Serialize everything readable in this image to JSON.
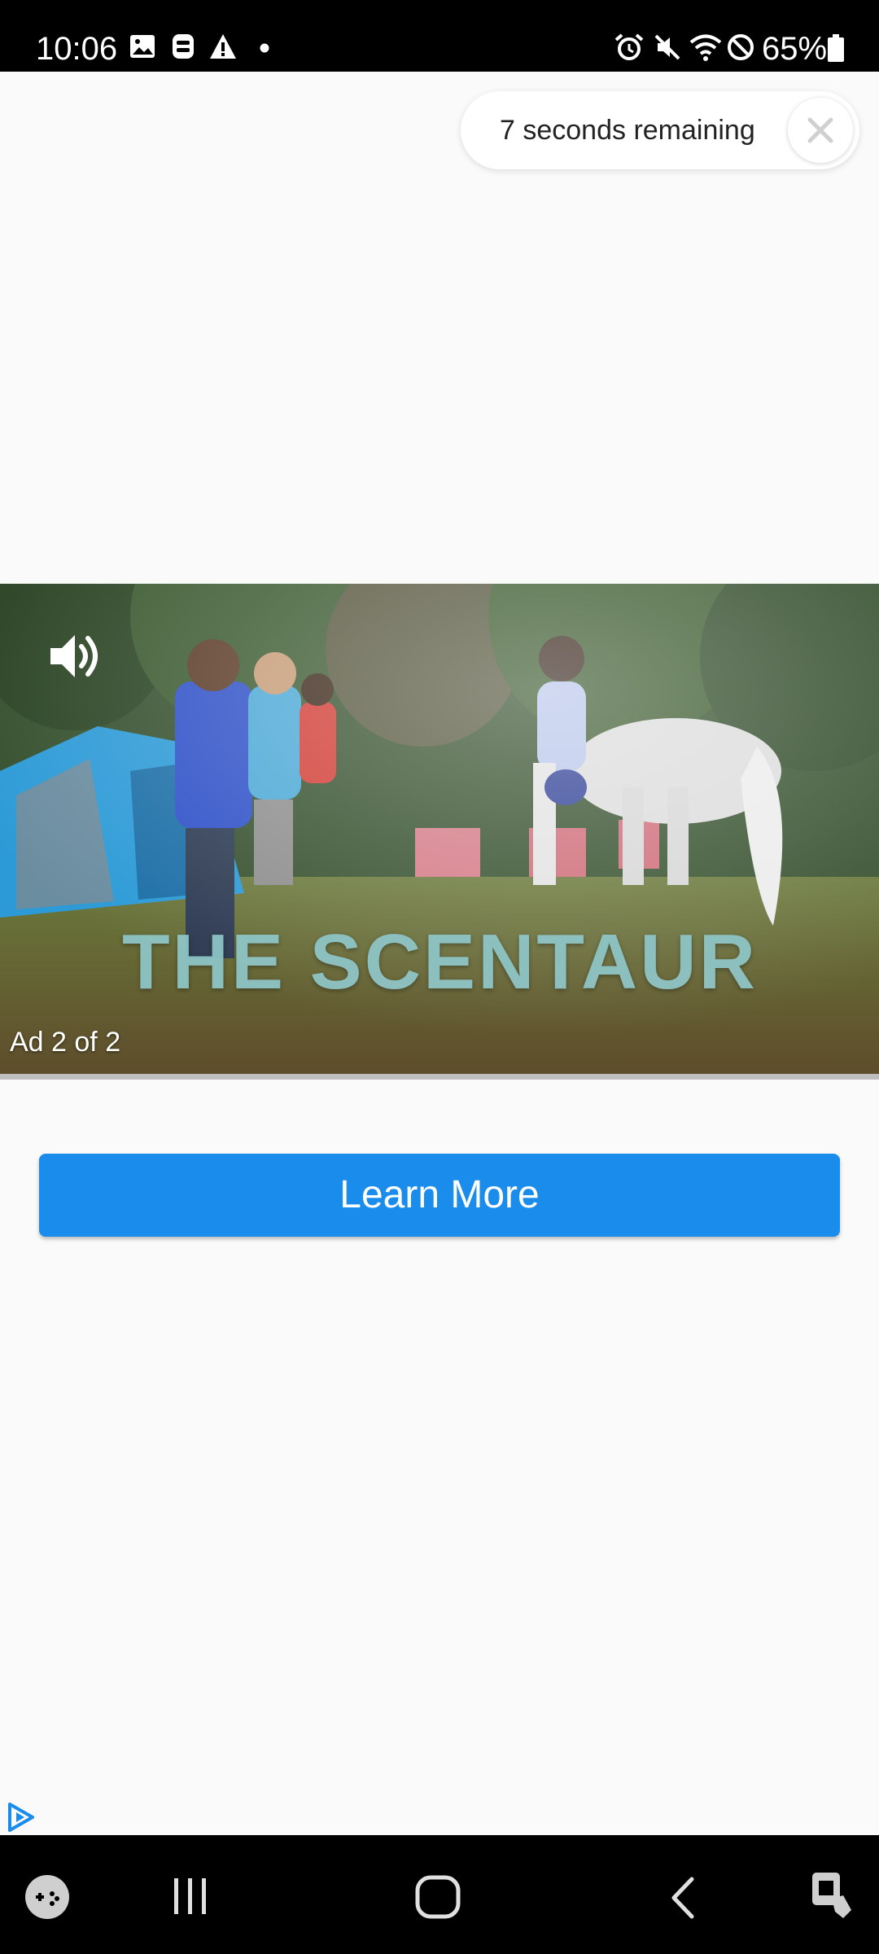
{
  "status_bar": {
    "time": "10:06",
    "battery_percent": "65%",
    "left_icons": [
      "gallery-icon",
      "wallet-icon",
      "warning-icon",
      "dot-icon"
    ],
    "right_icons": [
      "alarm-icon",
      "mute-icon",
      "wifi-icon",
      "dnd-icon",
      "battery-icon"
    ]
  },
  "ad": {
    "countdown_text": "7 seconds remaining",
    "counter_text": "Ad 2 of 2",
    "video_title_text": "THE SCENTAUR",
    "learn_more_label": "Learn More",
    "accent_color": "#1a8cec",
    "progress_fraction": 0.0
  },
  "nav_bar": {
    "icons": [
      "game-launcher-icon",
      "recents-icon",
      "home-icon",
      "back-icon",
      "assistant-icon"
    ]
  }
}
